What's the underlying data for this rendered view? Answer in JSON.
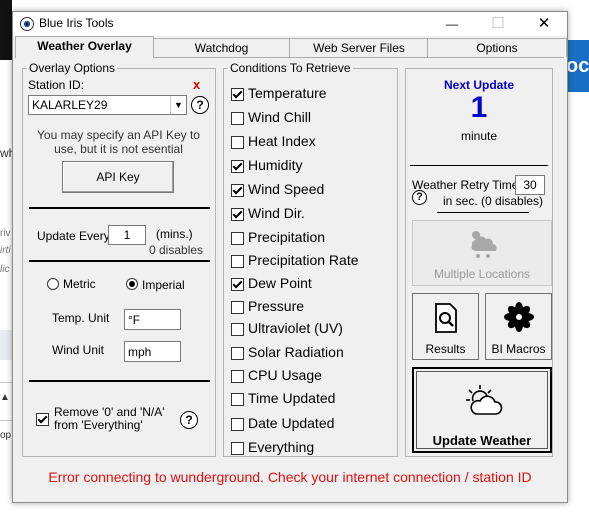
{
  "window": {
    "title": "Blue Iris Tools",
    "minimize": "—",
    "maximize": "☐",
    "close": "✕"
  },
  "tabs": [
    "Weather Overlay",
    "Watchdog",
    "Web Server Files",
    "Options"
  ],
  "overlay_options": {
    "group_title": "Overlay Options",
    "station_label": "Station ID:",
    "station_clear": "x",
    "station_value": "KALARLEY29",
    "help": "?",
    "api_note": "You may specify an API Key to use, but it is not esential",
    "api_button": "API Key",
    "update_every_label": "Update Every",
    "update_every_value": "1",
    "update_units": "(mins.)",
    "update_disable_note": "0 disables",
    "metric_label": "Metric",
    "imperial_label": "Imperial",
    "units_selected": "Imperial",
    "temp_unit_label": "Temp. Unit",
    "temp_unit_value": "°F",
    "wind_unit_label": "Wind Unit",
    "wind_unit_value": "mph",
    "remove_label": "Remove '0' and  'N/A' from 'Everything'",
    "remove_checked": true
  },
  "conditions": {
    "group_title": "Conditions To Retrieve",
    "items": [
      {
        "label": "Temperature",
        "checked": true
      },
      {
        "label": "Wind Chill",
        "checked": false
      },
      {
        "label": "Heat Index",
        "checked": false
      },
      {
        "label": "Humidity",
        "checked": true
      },
      {
        "label": "Wind Speed",
        "checked": true
      },
      {
        "label": "Wind Dir.",
        "checked": true
      },
      {
        "label": "Precipitation",
        "checked": false
      },
      {
        "label": "Precipitation Rate",
        "checked": false
      },
      {
        "label": "Dew Point",
        "checked": true
      },
      {
        "label": "Pressure",
        "checked": false
      },
      {
        "label": "Ultraviolet (UV)",
        "checked": false
      },
      {
        "label": "Solar Radiation",
        "checked": false
      },
      {
        "label": "CPU Usage",
        "checked": false
      },
      {
        "label": "Time Updated",
        "checked": false
      },
      {
        "label": "Date Updated",
        "checked": false
      },
      {
        "label": "Everything",
        "checked": false
      }
    ]
  },
  "right_panel": {
    "next_update_label": "Next Update",
    "next_update_value": "1",
    "next_update_unit": "minute",
    "retry_label": "Weather Retry Time",
    "retry_value": "30",
    "retry_unit": "in sec. (0 disables)",
    "multiple_locations": "Multiple Locations",
    "results": "Results",
    "bi_macros": "BI Macros",
    "update_weather": "Update Weather"
  },
  "status": {
    "error": "Error connecting to wunderground. Check your internet connection / station ID"
  },
  "background": {
    "side_texts": [
      "wh",
      "riv",
      "irti",
      "lic",
      "▲ ",
      "op"
    ],
    "blue_text": "oc"
  },
  "colors": {
    "accent_blue": "#0000cc",
    "error_red": "#e01010",
    "clear_red": "#e00000"
  }
}
